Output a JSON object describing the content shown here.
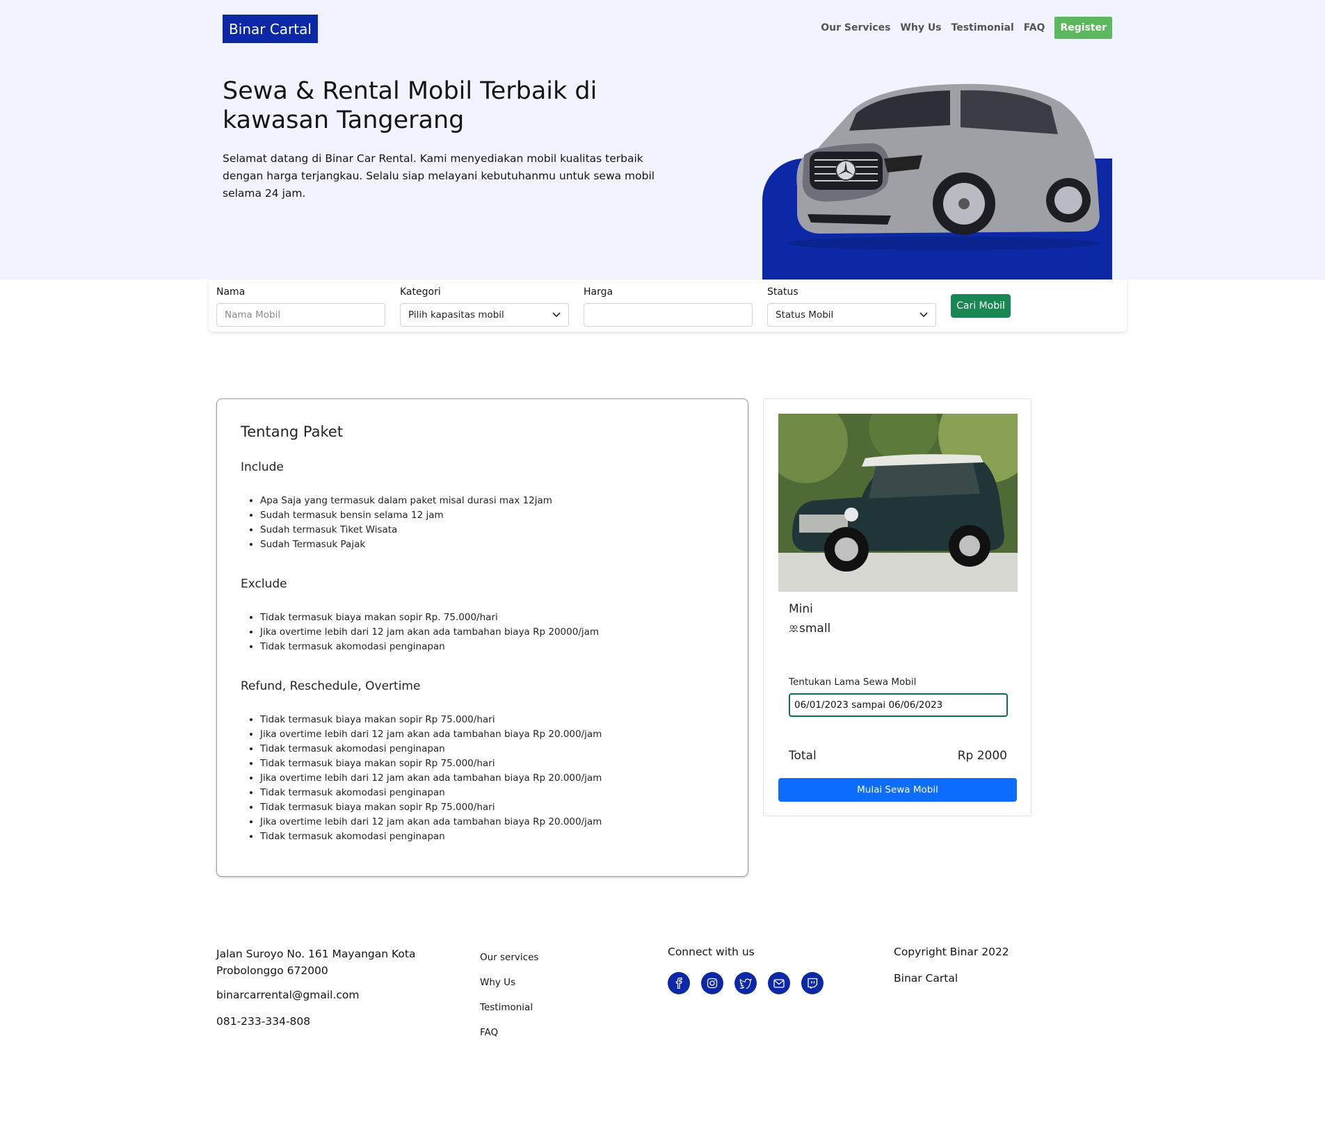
{
  "header": {
    "brand": "Binar Cartal",
    "nav": [
      "Our Services",
      "Why Us",
      "Testimonial",
      "FAQ"
    ],
    "register": "Register"
  },
  "hero": {
    "title": "Sewa & Rental Mobil Terbaik di kawasan Tangerang",
    "description": "Selamat datang di Binar Car Rental. Kami menyediakan mobil kualitas terbaik dengan harga terjangkau. Selalu siap melayani kebutuhanmu untuk sewa mobil selama 24 jam."
  },
  "search": {
    "nama_label": "Nama",
    "nama_placeholder": "Nama Mobil",
    "kategori_label": "Kategori",
    "kategori_value": "Pilih kapasitas mobil",
    "harga_label": "Harga",
    "harga_value": "",
    "status_label": "Status",
    "status_value": "Status Mobil",
    "button": "Cari Mobil"
  },
  "paket": {
    "title": "Tentang Paket",
    "include_title": "Include",
    "include": [
      "Apa Saja yang termasuk dalam paket misal durasi max 12jam",
      "Sudah termasuk bensin selama 12 jam",
      "Sudah termasuk Tiket Wisata",
      "Sudah Termasuk Pajak"
    ],
    "exclude_title": "Exclude",
    "exclude": [
      "Tidak termasuk biaya makan sopir Rp. 75.000/hari",
      "Jika overtime lebih dari 12 jam akan ada tambahan biaya Rp 20000/jam",
      "Tidak termasuk akomodasi penginapan"
    ],
    "refund_title": "Refund, Reschedule, Overtime",
    "refund": [
      "Tidak termasuk biaya makan sopir Rp 75.000/hari",
      "Jika overtime lebih dari 12 jam akan ada tambahan biaya Rp 20.000/jam",
      "Tidak termasuk akomodasi penginapan",
      "Tidak termasuk biaya makan sopir Rp 75.000/hari",
      "Jika overtime lebih dari 12 jam akan ada tambahan biaya Rp 20.000/jam",
      "Tidak termasuk akomodasi penginapan",
      "Tidak termasuk biaya makan sopir Rp 75.000/hari",
      "Jika overtime lebih dari 12 jam akan ada tambahan biaya Rp 20.000/jam",
      "Tidak termasuk akomodasi penginapan"
    ]
  },
  "rent": {
    "car_name": "Mini",
    "category": "small",
    "lama_label": "Tentukan Lama Sewa Mobil",
    "date_range": "06/01/2023 sampai 06/06/2023",
    "total_label": "Total",
    "total_value": "Rp 2000",
    "button": "Mulai Sewa Mobil"
  },
  "footer": {
    "address_line1": "Jalan Suroyo No. 161 Mayangan Kota",
    "address_line2": "Probolonggo 672000",
    "email": "binarcarrental@gmail.com",
    "phone": "081-233-334-808",
    "links": [
      "Our services",
      "Why Us",
      "Testimonial",
      "FAQ"
    ],
    "connect": "Connect with us",
    "socials": [
      "facebook-icon",
      "instagram-icon",
      "twitter-icon",
      "mail-icon",
      "twitch-icon"
    ],
    "copyright": "Copyright Binar 2022",
    "brand": "Binar Cartal"
  },
  "colors": {
    "brand": "#0d28a6",
    "hero_bg": "#f1f3fe",
    "register": "#5cb85c",
    "search_btn": "#198754",
    "rent_btn": "#0d6efd"
  }
}
